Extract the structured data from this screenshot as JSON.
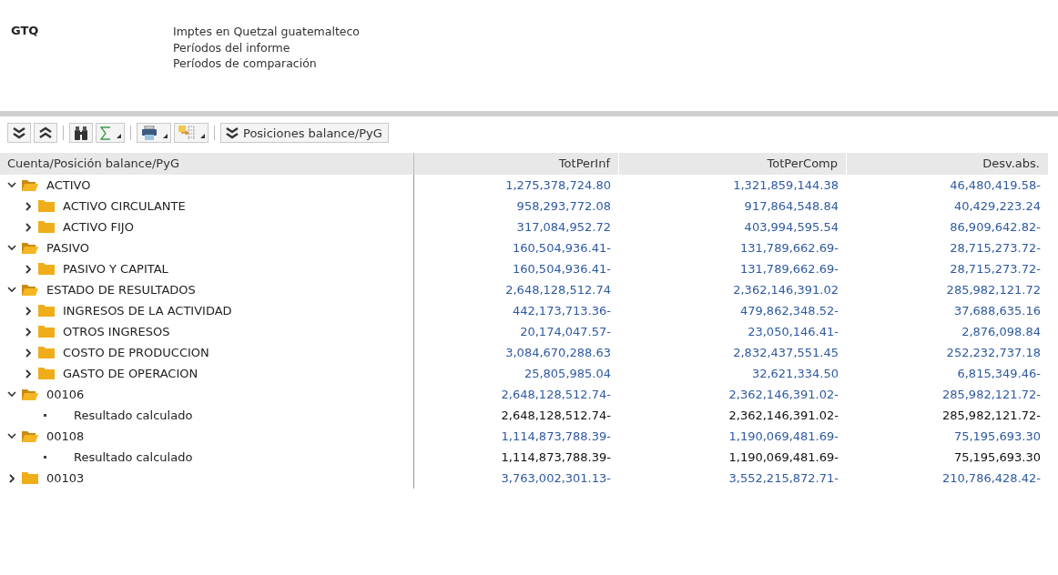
{
  "header": {
    "currency": "GTQ",
    "lines": [
      "Imptes en Quetzal guatemalteco",
      "Períodos del informe",
      "Períodos de comparación"
    ]
  },
  "toolbar": {
    "buttons": [
      {
        "kind": "expand"
      },
      {
        "kind": "collapse"
      },
      {
        "kind": "find"
      },
      {
        "kind": "sum"
      },
      {
        "kind": "print"
      },
      {
        "kind": "export"
      }
    ],
    "hierarchy_button": "Posiciones balance/PyG"
  },
  "table": {
    "columns": [
      "Cuenta/Posición balance/PyG",
      "TotPerInf",
      "TotPerComp",
      "Desv.abs."
    ],
    "rows": [
      {
        "kind": "folder",
        "expanded": true,
        "label": "ACTIVO",
        "values": [
          "1,275,378,724.80",
          "1,321,859,144.38",
          "46,480,419.58-"
        ],
        "children": [
          {
            "kind": "folder",
            "expanded": false,
            "label": "ACTIVO CIRCULANTE",
            "values": [
              "958,293,772.08",
              "917,864,548.84",
              "40,429,223.24"
            ]
          },
          {
            "kind": "folder",
            "expanded": false,
            "label": "ACTIVO FIJO",
            "values": [
              "317,084,952.72",
              "403,994,595.54",
              "86,909,642.82-"
            ]
          }
        ]
      },
      {
        "kind": "folder",
        "expanded": true,
        "label": "PASIVO",
        "values": [
          "160,504,936.41-",
          "131,789,662.69-",
          "28,715,273.72-"
        ],
        "children": [
          {
            "kind": "folder",
            "expanded": false,
            "label": "PASIVO Y CAPITAL",
            "values": [
              "160,504,936.41-",
              "131,789,662.69-",
              "28,715,273.72-"
            ]
          }
        ]
      },
      {
        "kind": "folder",
        "expanded": true,
        "label": "ESTADO DE RESULTADOS",
        "values": [
          "2,648,128,512.74",
          "2,362,146,391.02",
          "285,982,121.72"
        ],
        "children": [
          {
            "kind": "folder",
            "expanded": false,
            "label": "INGRESOS DE LA ACTIVIDAD",
            "values": [
              "442,173,713.36-",
              "479,862,348.52-",
              "37,688,635.16"
            ]
          },
          {
            "kind": "folder",
            "expanded": false,
            "label": "OTROS INGRESOS",
            "values": [
              "20,174,047.57-",
              "23,050,146.41-",
              "2,876,098.84"
            ]
          },
          {
            "kind": "folder",
            "expanded": false,
            "label": "COSTO DE PRODUCCION",
            "values": [
              "3,084,670,288.63",
              "2,832,437,551.45",
              "252,232,737.18"
            ]
          },
          {
            "kind": "folder",
            "expanded": false,
            "label": "GASTO DE OPERACION",
            "values": [
              "25,805,985.04",
              "32,621,334.50",
              "6,815,349.46-"
            ]
          }
        ]
      },
      {
        "kind": "folder",
        "expanded": true,
        "label": "00106",
        "values": [
          "2,648,128,512.74-",
          "2,362,146,391.02-",
          "285,982,121.72-"
        ],
        "children": [
          {
            "kind": "result",
            "label": "Resultado calculado",
            "values": [
              "2,648,128,512.74-",
              "2,362,146,391.02-",
              "285,982,121.72-"
            ]
          }
        ]
      },
      {
        "kind": "folder",
        "expanded": true,
        "label": "00108",
        "values": [
          "1,114,873,788.39-",
          "1,190,069,481.69-",
          "75,195,693.30"
        ],
        "children": [
          {
            "kind": "result",
            "label": "Resultado calculado",
            "values": [
              "1,114,873,788.39-",
              "1,190,069,481.69-",
              "75,195,693.30"
            ]
          }
        ]
      },
      {
        "kind": "folder",
        "expanded": false,
        "label": "00103",
        "values": [
          "3,763,002,301.13-",
          "3,552,215,872.71-",
          "210,786,428.42-"
        ]
      }
    ]
  }
}
